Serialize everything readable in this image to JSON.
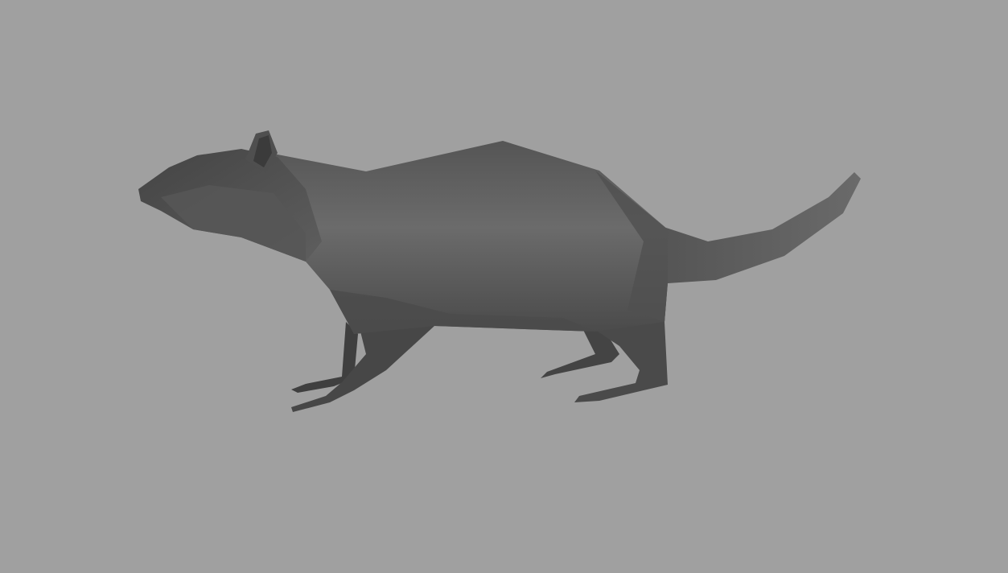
{
  "scene": {
    "subject": "rat-model",
    "colors": {
      "background": "#a0a0a0",
      "body_light": "#6a6a6a",
      "body_mid": "#5a5a5a",
      "body_dark": "#3e3e3e"
    }
  }
}
